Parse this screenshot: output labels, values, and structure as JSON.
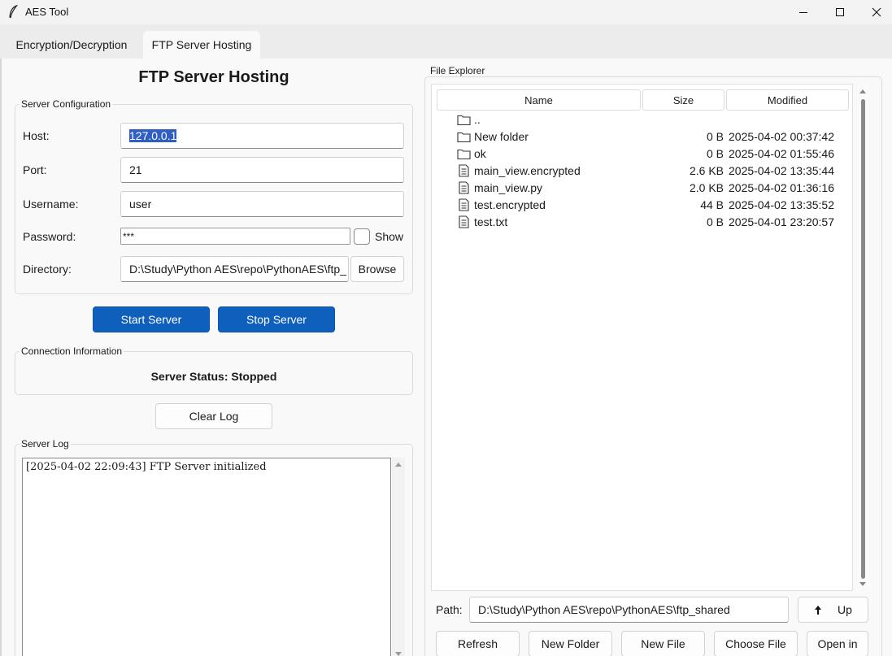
{
  "window": {
    "title": "AES Tool"
  },
  "tabs": [
    {
      "label": "Encryption/Decryption"
    },
    {
      "label": "FTP Server Hosting"
    }
  ],
  "left": {
    "heading": "FTP Server Hosting",
    "server_config": {
      "group_label": "Server Configuration",
      "host_label": "Host:",
      "host_value": "127.0.0.1",
      "port_label": "Port:",
      "port_value": "21",
      "username_label": "Username:",
      "username_value": "user",
      "password_label": "Password:",
      "password_value": "***",
      "show_label": "Show",
      "directory_label": "Directory:",
      "directory_value": "D:\\Study\\Python AES\\repo\\PythonAES\\ftp_",
      "browse_label": "Browse"
    },
    "start_label": "Start Server",
    "stop_label": "Stop Server",
    "connection": {
      "group_label": "Connection Information",
      "status_text": "Server Status: Stopped"
    },
    "clear_log_label": "Clear Log",
    "log": {
      "group_label": "Server Log",
      "lines": [
        "[2025-04-02 22:09:43] FTP Server initialized"
      ]
    }
  },
  "explorer": {
    "group_label": "File Explorer",
    "columns": [
      "Name",
      "Size",
      "Modified"
    ],
    "rows": [
      {
        "icon": "folder-icon",
        "name": "..",
        "size": "",
        "modified": ""
      },
      {
        "icon": "folder-icon",
        "name": "New folder",
        "size": "0 B",
        "modified": "2025-04-02 00:37:42"
      },
      {
        "icon": "folder-icon",
        "name": "ok",
        "size": "0 B",
        "modified": "2025-04-02 01:55:46"
      },
      {
        "icon": "file-icon",
        "name": "main_view.encrypted",
        "size": "2.6 KB",
        "modified": "2025-04-02 13:35:44"
      },
      {
        "icon": "file-icon",
        "name": "main_view.py",
        "size": "2.0 KB",
        "modified": "2025-04-02 01:36:16"
      },
      {
        "icon": "file-icon",
        "name": "test.encrypted",
        "size": "44 B",
        "modified": "2025-04-02 13:35:52"
      },
      {
        "icon": "file-icon",
        "name": "test.txt",
        "size": "0 B",
        "modified": "2025-04-01 23:20:57"
      }
    ],
    "path_label": "Path:",
    "path_value": "D:\\Study\\Python AES\\repo\\PythonAES\\ftp_shared",
    "up_label": "Up",
    "actions": {
      "refresh": "Refresh",
      "new_folder": "New Folder",
      "new_file": "New File",
      "choose_file": "Choose File",
      "open_in": "Open in"
    }
  },
  "colors": {
    "primary": "#0f5fbd",
    "selection": "#2f5fc4"
  }
}
